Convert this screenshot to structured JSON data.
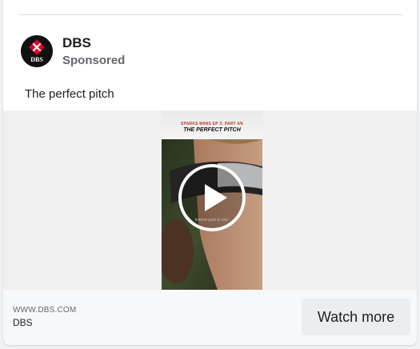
{
  "post": {
    "advertiser_name": "DBS",
    "sponsored_label": "Sponsored",
    "caption": "The perfect pitch"
  },
  "video": {
    "kicker": "SPARKS MINIS EP 3: PART 4/6",
    "headline": "THE PERFECT PITCH",
    "subtitle": "marine park in one."
  },
  "footer": {
    "domain": "WWW.DBS.COM",
    "advertiser": "DBS",
    "cta_label": "Watch more"
  },
  "icons": {
    "avatar": "dbs-logo-icon",
    "play": "play-icon"
  },
  "colors": {
    "brand_red": "#e4002b",
    "avatar_bg": "#111111",
    "cta_bg": "#ebedf0",
    "text_primary": "#1c1e21",
    "text_secondary": "#65676b"
  }
}
